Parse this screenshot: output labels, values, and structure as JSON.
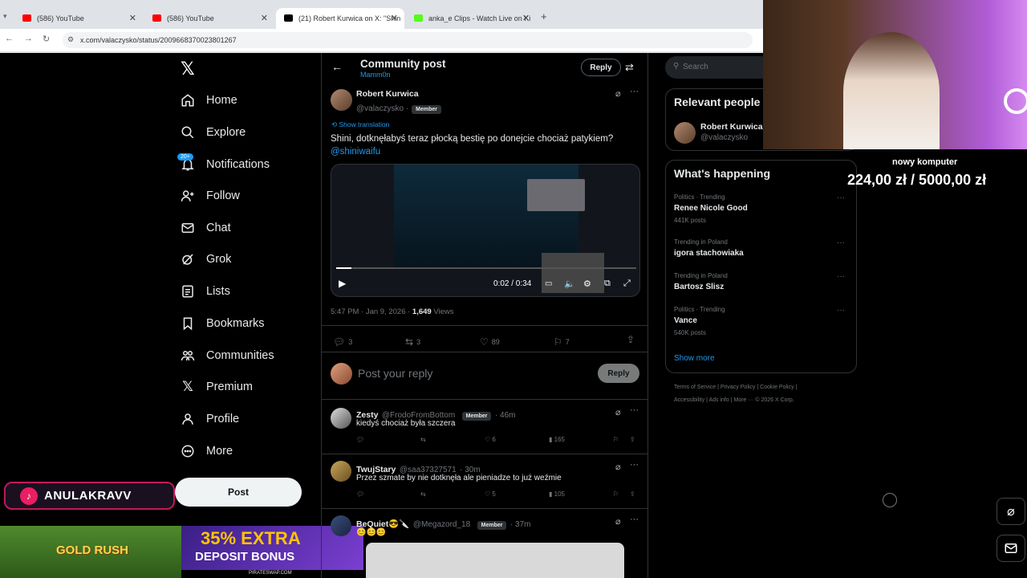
{
  "browser": {
    "tabs": [
      {
        "label": "(586) YouTube",
        "color": "#ff0000"
      },
      {
        "label": "(586) YouTube",
        "color": "#ff0000"
      },
      {
        "label": "(21) Robert Kurwica on X: \"Shin",
        "color": "#000000"
      },
      {
        "label": "anka_e Clips - Watch Live on Ki",
        "color": "#53fc18"
      }
    ],
    "url": "x.com/valaczysko/status/2009668370023801267"
  },
  "sidebar": {
    "items": [
      {
        "label": "Home",
        "icon": "home-icon"
      },
      {
        "label": "Explore",
        "icon": "search-icon"
      },
      {
        "label": "Notifications",
        "icon": "bell-icon",
        "badge": "20+"
      },
      {
        "label": "Follow",
        "icon": "follow-icon"
      },
      {
        "label": "Chat",
        "icon": "mail-icon"
      },
      {
        "label": "Grok",
        "icon": "grok-icon"
      },
      {
        "label": "Lists",
        "icon": "lists-icon"
      },
      {
        "label": "Bookmarks",
        "icon": "bookmark-icon"
      },
      {
        "label": "Communities",
        "icon": "communities-icon"
      },
      {
        "label": "Premium",
        "icon": "x-icon"
      },
      {
        "label": "Profile",
        "icon": "profile-icon"
      },
      {
        "label": "More",
        "icon": "more-icon"
      }
    ],
    "post_label": "Post"
  },
  "overlay": {
    "tiktok": "ANULAKRAVV",
    "ad_left": "GOLD RUSH",
    "ad_mid_1": "35% EXTRA",
    "ad_mid_2": "DEPOSIT BONUS",
    "ad_mid_3": "PIRATESWAP.COM",
    "donation_title": "nowy komputer",
    "donation_amount": "224,00 zł / 5000,00 zł"
  },
  "post": {
    "header_title": "Community post",
    "header_sub": "Mamm0n",
    "reply_pill": "Reply",
    "author_name": "Robert Kurwica",
    "author_handle": "@valaczysko",
    "member": "Member",
    "translation": "Show translation",
    "text": "Shini, dotknęłabyś teraz płocką bestię po donejcie chociaż patykiem?",
    "mention": "@shiniwaifu",
    "video_time": "0:02 / 0:34",
    "meta_time": "5:47 PM · Jan 9, 2026 ·",
    "views_count": "1,649",
    "views_label": "Views",
    "replies": "3",
    "reposts": "3",
    "likes": "89",
    "bookmarks": "7",
    "reply_placeholder": "Post your reply",
    "reply_button": "Reply"
  },
  "replies": [
    {
      "name": "Zesty",
      "handle": "@FrodoFromBottom",
      "member": "Member",
      "time": "· 46m",
      "text": "kiedyś chociaż była szczera",
      "likes": "6",
      "views": "165"
    },
    {
      "name": "TwujStary",
      "handle": "@saa37327571",
      "time": "· 30m",
      "text": "Przez szmate by nie dotknęła ale pieniadze to już weźmie",
      "likes": "5",
      "views": "105"
    },
    {
      "name": "BeQuiet😎🔪",
      "handle": "@Megazord_18",
      "member": "Member",
      "time": "· 37m",
      "text": "😊😊😊"
    }
  ],
  "right": {
    "search_placeholder": "Search",
    "relevant_title": "Relevant people",
    "relevant_name": "Robert Kurwica",
    "relevant_handle": "@valaczysko",
    "happening_title": "What's happening",
    "trends": [
      {
        "category": "Politics · Trending",
        "name": "Renee Nicole Good",
        "count": "441K posts"
      },
      {
        "category": "Trending in Poland",
        "name": "igora stachowiaka"
      },
      {
        "category": "Trending in Poland",
        "name": "Bartosz Slisz"
      },
      {
        "category": "Politics · Trending",
        "name": "Vance",
        "count": "540K posts"
      }
    ],
    "show_more": "Show more",
    "footer_1": [
      "Terms of Service",
      "|",
      "Privacy Policy",
      "|",
      "Cookie Policy",
      "|"
    ],
    "footer_2": [
      "Accessibility",
      "|",
      "Ads info",
      "|",
      "More ···",
      "© 2026 X Corp."
    ]
  }
}
